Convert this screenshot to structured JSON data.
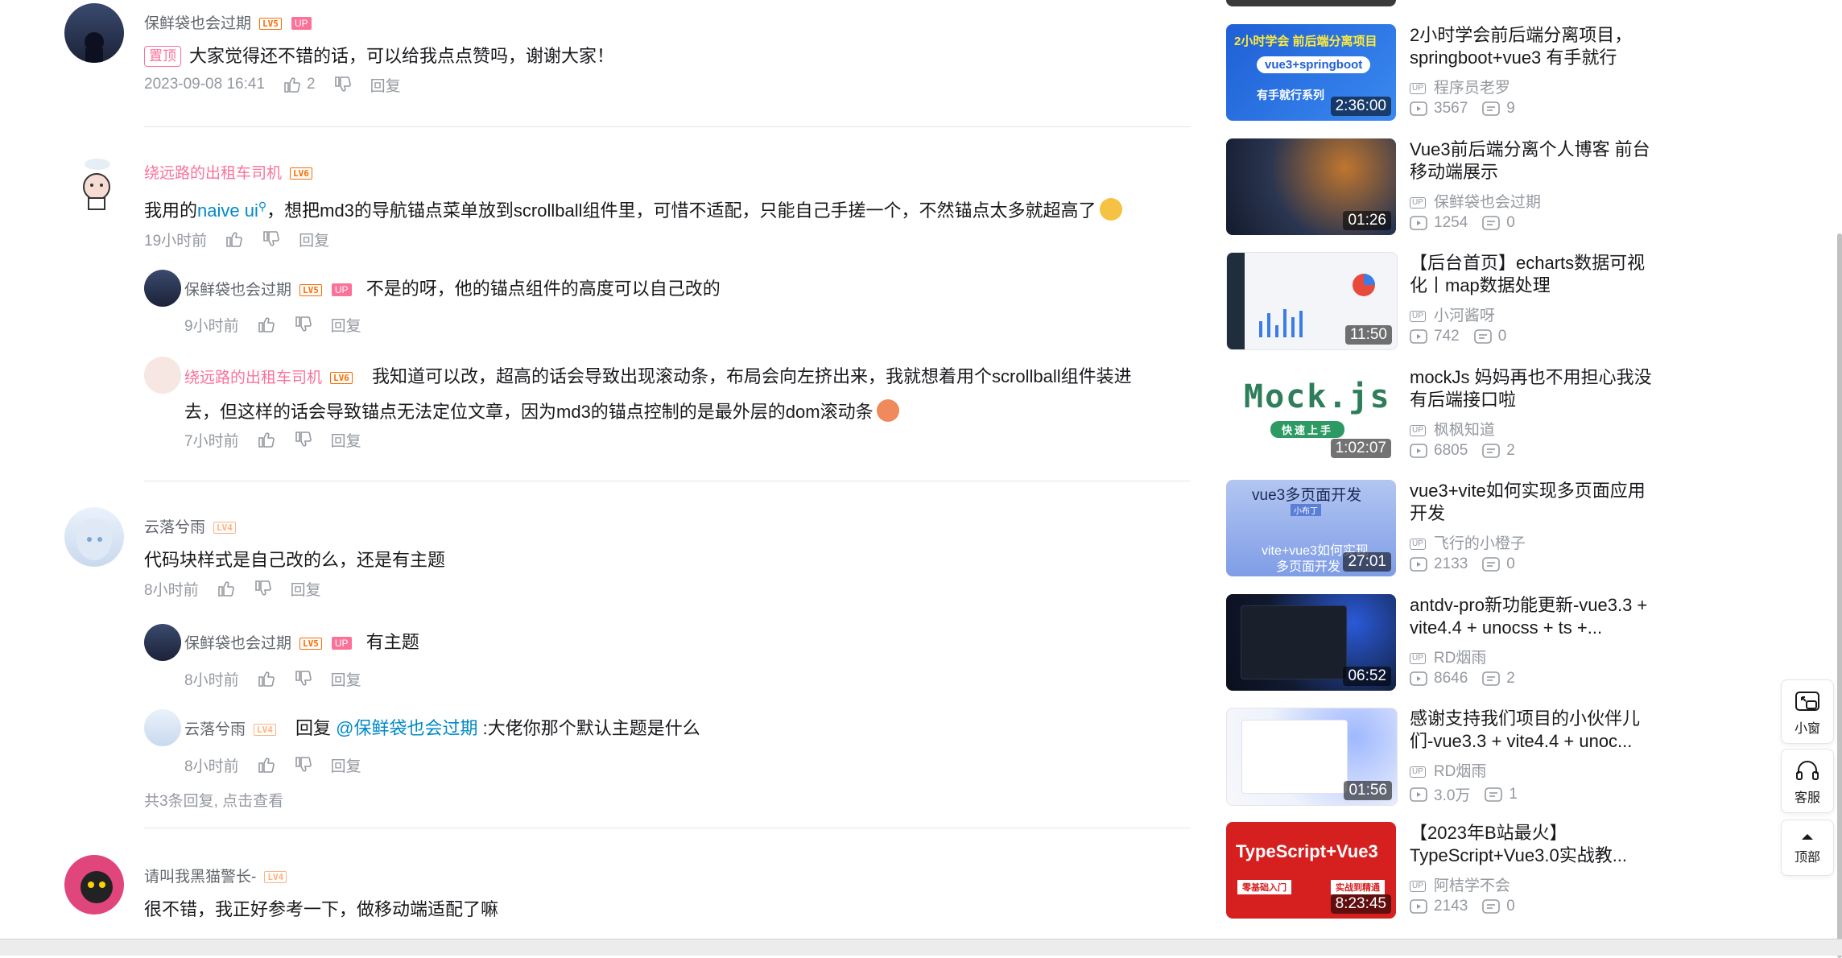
{
  "comments": [
    {
      "user": "保鲜袋也会过期",
      "level": "LV5",
      "up_badge": "UP",
      "pinned_label": "置顶",
      "text": "大家觉得还不错的话，可以给我点点赞吗，谢谢大家！",
      "time": "2023-09-08 16:41",
      "likes": "2",
      "reply_label": "回复"
    },
    {
      "user": "绕远路的出租车司机",
      "level": "LV6",
      "text_before": "我用的",
      "text_link": "naive ui",
      "text_after": "，想把md3的导航锚点菜单放到scrollball组件里，可惜不适配，只能自己手搓一个，不然锚点太多就超高了",
      "time": "19小时前",
      "reply_label": "回复",
      "replies": [
        {
          "user": "保鲜袋也会过期",
          "level": "LV5",
          "up_badge": "UP",
          "text": "不是的呀，他的锚点组件的高度可以自己改的",
          "time": "9小时前",
          "reply_label": "回复"
        },
        {
          "user": "绕远路的出租车司机",
          "level": "LV6",
          "text_line1": "我知道可以改，超高的话会导致出现滚动条，布局会向左挤出来，我就想着用个scrollball组件装进",
          "text_line2": "去，但这样的话会导致锚点无法定位文章，因为md3的锚点控制的是最外层的dom滚动条",
          "time": "7小时前",
          "reply_label": "回复"
        }
      ]
    },
    {
      "user": "云落兮雨",
      "level": "LV4",
      "text": "代码块样式是自己改的么，还是有主题",
      "time": "8小时前",
      "reply_label": "回复",
      "replies": [
        {
          "user": "保鲜袋也会过期",
          "level": "LV5",
          "up_badge": "UP",
          "text": "有主题",
          "time": "8小时前",
          "reply_label": "回复"
        },
        {
          "user": "云落兮雨",
          "level": "LV4",
          "reply_prefix": "回复 ",
          "mention": "@保鲜袋也会过期",
          "text": " :大佬你那个默认主题是什么",
          "time": "8小时前",
          "reply_label": "回复"
        }
      ],
      "view_all": "共3条回复, 点击查看"
    },
    {
      "user": "请叫我黑猫警长-",
      "level": "LV4",
      "text": "很不错，我正好参考一下，做移动端适配了嘛"
    }
  ],
  "recommendations": [
    {
      "title": "2小时学会前后端分离项目，springboot+vue3 有手就行",
      "up": "程序员老罗",
      "views": "3567",
      "danmaku": "9",
      "duration": "2:36:00",
      "thumb_text": [
        "2小时学会 前后端分离项目",
        "vue3+springboot",
        "有手就行系列"
      ]
    },
    {
      "title": "Vue3前后端分离个人博客 前台移动端展示",
      "up": "保鲜袋也会过期",
      "views": "1254",
      "danmaku": "0",
      "duration": "01:26"
    },
    {
      "title": "【后台首页】echarts数据可视化丨map数据处理",
      "up": "小河酱呀",
      "views": "742",
      "danmaku": "0",
      "duration": "11:50"
    },
    {
      "title": "mockJs 妈妈再也不用担心我没有后端接口啦",
      "up": "枫枫知道",
      "views": "6805",
      "danmaku": "2",
      "duration": "1:02:07",
      "thumb_text": [
        "Mock.js",
        "快速上手"
      ]
    },
    {
      "title": "vue3+vite如何实现多页面应用开发",
      "up": "飞行的小橙子",
      "views": "2133",
      "danmaku": "0",
      "duration": "27:01",
      "thumb_text": [
        "vue3多页面开发",
        "小布丁",
        "vite+vue3如何实现",
        "多页面开发"
      ]
    },
    {
      "title": "antdv-pro新功能更新-vue3.3 + vite4.4 + unocss + ts +...",
      "up": "RD烟雨",
      "views": "8646",
      "danmaku": "2",
      "duration": "06:52"
    },
    {
      "title": "感谢支持我们项目的小伙伴儿们-vue3.3 + vite4.4 + unoc...",
      "up": "RD烟雨",
      "views": "3.0万",
      "danmaku": "1",
      "duration": "01:56"
    },
    {
      "title": "【2023年B站最火】TypeScript+Vue3.0实战教...",
      "up": "阿桔学不会",
      "views": "2143",
      "danmaku": "0",
      "duration": "8:23:45",
      "thumb_text": [
        "TypeScript+Vue3",
        "零基础入门",
        "实战到精通"
      ]
    }
  ],
  "up_badge_small": "UP",
  "float_buttons": {
    "mini": "小窗",
    "service": "客服",
    "top": "顶部"
  },
  "colors": {
    "accent": "#fb7299",
    "link": "#008ac5",
    "level": "#ff6a00",
    "muted": "#9499a0"
  }
}
